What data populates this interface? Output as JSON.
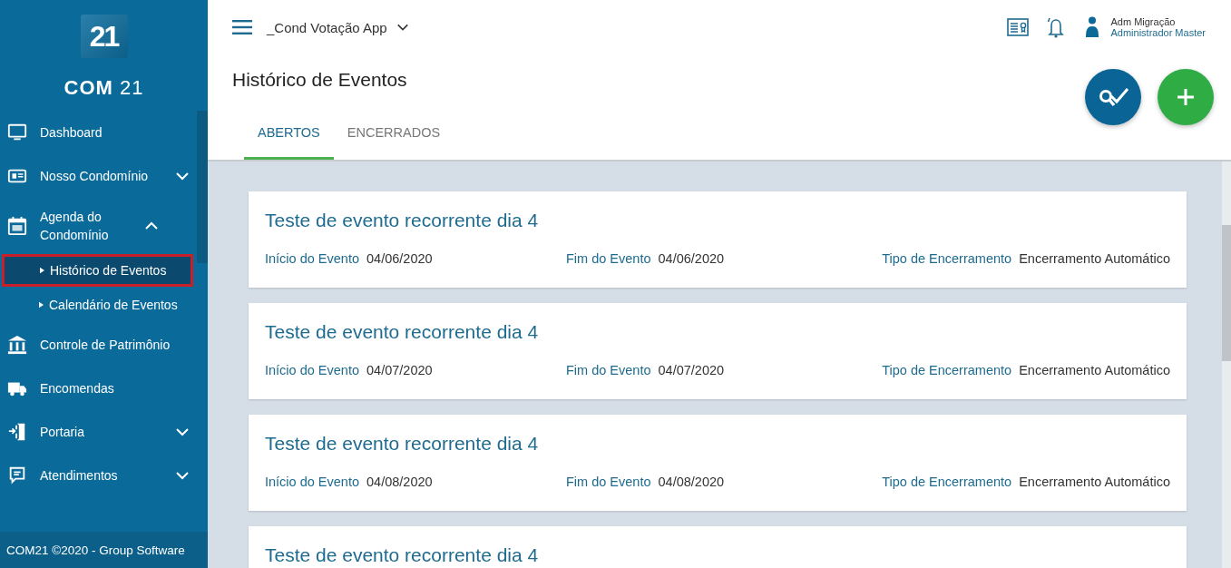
{
  "sidebar": {
    "brand": "COM",
    "brand_number": "21",
    "logo_number": "21",
    "items": [
      {
        "label": "Dashboard",
        "expandable": false
      },
      {
        "label": "Nosso Condomínio",
        "expandable": true,
        "expanded": false
      },
      {
        "label": "Agenda do Condomínio",
        "expandable": true,
        "expanded": true,
        "children": [
          {
            "label": "Histórico de Eventos",
            "selected": true
          },
          {
            "label": "Calendário de Eventos",
            "selected": false
          }
        ]
      },
      {
        "label": "Controle de Patrimônio",
        "expandable": false
      },
      {
        "label": "Encomendas",
        "expandable": false
      },
      {
        "label": "Portaria",
        "expandable": true,
        "expanded": false
      },
      {
        "label": "Atendimentos",
        "expandable": true,
        "expanded": false
      }
    ],
    "footer": "COM21 ©2020 - Group Software"
  },
  "header": {
    "app": "_Cond Votação App",
    "user_name": "Adm Migração",
    "user_role": "Administrador Master"
  },
  "page": {
    "title": "Histórico de Eventos"
  },
  "tabs": [
    {
      "label": "ABERTOS",
      "selected": true
    },
    {
      "label": "ENCERRADOS",
      "selected": false
    }
  ],
  "events": [
    {
      "title": "Teste de evento recorrente dia 4",
      "start_label": "Início do Evento",
      "start": "04/06/2020",
      "end_label": "Fim do Evento",
      "end": "04/06/2020",
      "close_label": "Tipo de Encerramento",
      "close": "Encerramento Automático"
    },
    {
      "title": "Teste de evento recorrente dia 4",
      "start_label": "Início do Evento",
      "start": "04/07/2020",
      "end_label": "Fim do Evento",
      "end": "04/07/2020",
      "close_label": "Tipo de Encerramento",
      "close": "Encerramento Automático"
    },
    {
      "title": "Teste de evento recorrente dia 4",
      "start_label": "Início do Evento",
      "start": "04/08/2020",
      "end_label": "Fim do Evento",
      "end": "04/08/2020",
      "close_label": "Tipo de Encerramento",
      "close": "Encerramento Automático"
    },
    {
      "title": "Teste de evento recorrente dia 4"
    }
  ]
}
